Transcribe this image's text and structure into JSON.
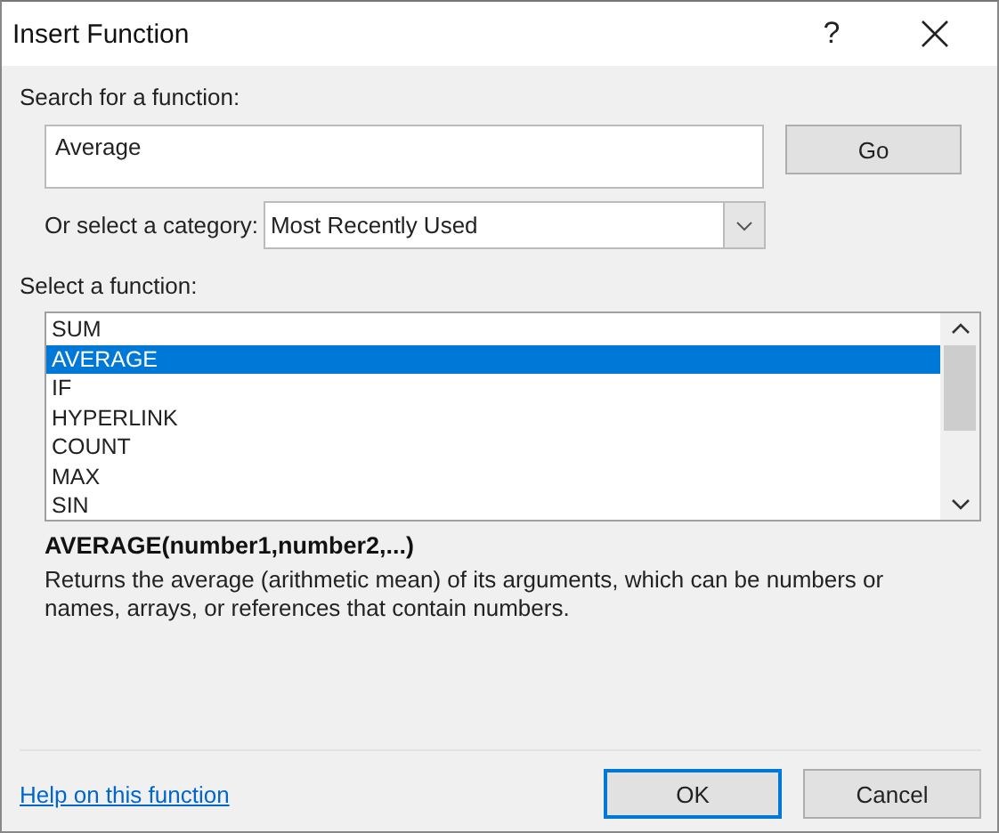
{
  "window": {
    "title": "Insert Function",
    "help_button": "?"
  },
  "search": {
    "label": "Search for a function:",
    "value": "Average",
    "go_button": "Go"
  },
  "category": {
    "label": "Or select a category:",
    "value": "Most Recently Used"
  },
  "functions": {
    "label": "Select a function:",
    "items": [
      {
        "name": "SUM",
        "selected": false
      },
      {
        "name": "AVERAGE",
        "selected": true
      },
      {
        "name": "IF",
        "selected": false
      },
      {
        "name": "HYPERLINK",
        "selected": false
      },
      {
        "name": "COUNT",
        "selected": false
      },
      {
        "name": "MAX",
        "selected": false
      },
      {
        "name": "SIN",
        "selected": false
      }
    ]
  },
  "signature": "AVERAGE(number1,number2,...)",
  "description": "Returns the average (arithmetic mean) of its arguments, which can be numbers or names, arrays, or references that contain numbers.",
  "help_link": "Help on this function",
  "buttons": [
    {
      "label": "OK",
      "default": true
    },
    {
      "label": "Cancel",
      "default": false
    }
  ]
}
